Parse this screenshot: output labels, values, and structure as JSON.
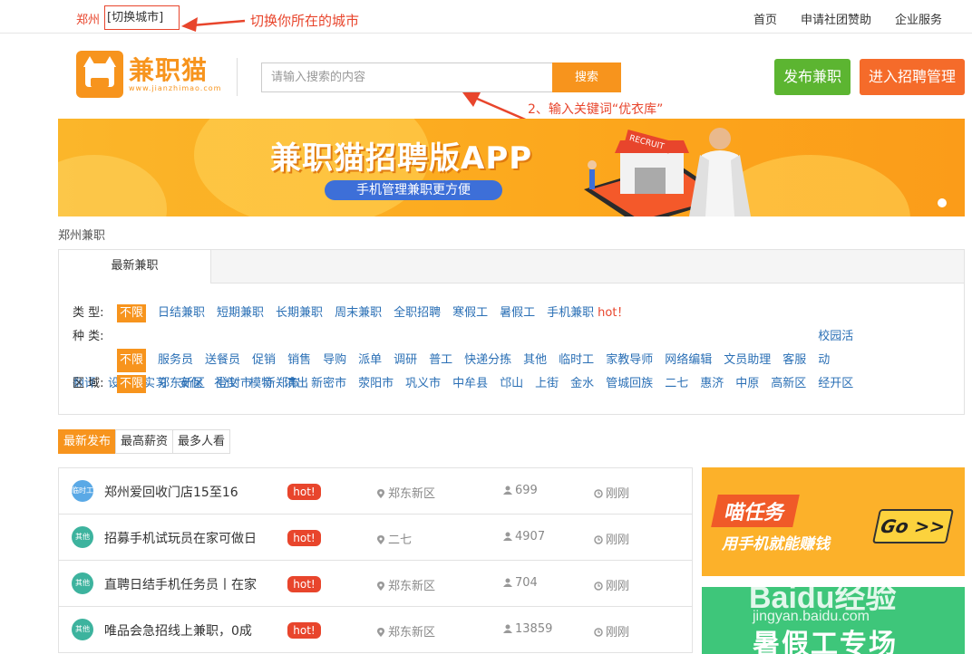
{
  "topbar": {
    "city": "郑州",
    "switch_city": "[切换城市]",
    "annotation": "切换你所在的城市",
    "links": [
      "首页",
      "申请社团赞助",
      "企业服务"
    ]
  },
  "header": {
    "logo_name": "兼职猫",
    "logo_url": "www.jianzhimao.com",
    "search_placeholder": "请输入搜索的内容",
    "search_button": "搜索",
    "annotation": "2、输入关键词“优衣库”",
    "publish_button": "发布兼职",
    "manage_button": "进入招聘管理"
  },
  "banner": {
    "title": "兼职猫招聘版APP",
    "subtitle": "手机管理兼职更方便",
    "sign_text": "RECRUIT"
  },
  "breadcrumb": "郑州兼职",
  "filter": {
    "tab": "最新兼职",
    "type_label": "类  型:",
    "type_items": [
      "不限",
      "日结兼职",
      "短期兼职",
      "长期兼职",
      "周末兼职",
      "全职招聘",
      "寒假工",
      "暑假工",
      "手机兼职"
    ],
    "type_hot": "hot！",
    "category_label": "种  类:",
    "category_items": [
      "不限",
      "服务员",
      "送餐员",
      "促销",
      "销售",
      "导购",
      "派单",
      "调研",
      "普工",
      "快递分拣",
      "其他",
      "临时工",
      "家教导师",
      "网络编辑",
      "文员助理",
      "客服",
      "校园活动",
      "翻译",
      "设计",
      "实习",
      "安保",
      "礼仪",
      "模特",
      "演出"
    ],
    "area_label": "区  域:",
    "area_items": [
      "不限",
      "郑东新区",
      "登封市",
      "新郑市",
      "新密市",
      "荥阳市",
      "巩义市",
      "中牟县",
      "邙山",
      "上街",
      "金水",
      "管城回族",
      "二七",
      "惠济",
      "中原",
      "高新区",
      "经开区"
    ]
  },
  "sort_tabs": [
    "最新发布",
    "最高薪资",
    "最多人看"
  ],
  "jobs": [
    {
      "cat": "临时工",
      "cat_color": "#5aa9e6",
      "title": "郑州爱回收门店15至16",
      "hot": "hot!",
      "location": "郑东新区",
      "views": "699",
      "time": "刚刚"
    },
    {
      "cat": "其他",
      "cat_color": "#3db39e",
      "title": "招募手机试玩员在家可做日",
      "hot": "hot!",
      "location": "二七",
      "views": "4907",
      "time": "刚刚"
    },
    {
      "cat": "其他",
      "cat_color": "#3db39e",
      "title": "直聘日结手机任务员丨在家",
      "hot": "hot!",
      "location": "郑东新区",
      "views": "704",
      "time": "刚刚"
    },
    {
      "cat": "其他",
      "cat_color": "#3db39e",
      "title": "唯品会急招线上兼职，0成",
      "hot": "hot!",
      "location": "郑东新区",
      "views": "13859",
      "time": "刚刚"
    }
  ],
  "ads": {
    "ad1_title": "喵任务",
    "ad1_sub": "用手机就能赚钱",
    "ad1_go": "Go >>",
    "ad2_text": "暑假工专场"
  },
  "watermark": {
    "main": "Baidu经验",
    "sub": "jingyan.baidu.com"
  }
}
